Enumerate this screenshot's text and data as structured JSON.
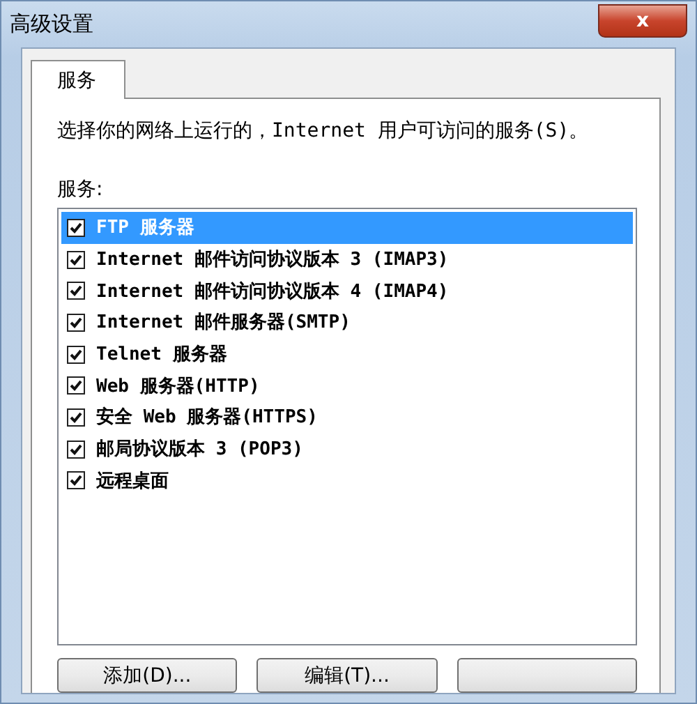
{
  "window": {
    "title": "高级设置",
    "close_label": "x"
  },
  "tabs": [
    {
      "label": "服务",
      "selected": true
    }
  ],
  "description": "选择你的网络上运行的，Internet 用户可访问的服务(S)。",
  "list_label": "服务:",
  "services": [
    {
      "label": "FTP 服务器",
      "checked": true,
      "selected": true
    },
    {
      "label": "Internet 邮件访问协议版本 3 (IMAP3)",
      "checked": true,
      "selected": false
    },
    {
      "label": "Internet 邮件访问协议版本 4 (IMAP4)",
      "checked": true,
      "selected": false
    },
    {
      "label": "Internet 邮件服务器(SMTP)",
      "checked": true,
      "selected": false
    },
    {
      "label": "Telnet 服务器",
      "checked": true,
      "selected": false
    },
    {
      "label": "Web 服务器(HTTP)",
      "checked": true,
      "selected": false
    },
    {
      "label": "安全 Web 服务器(HTTPS)",
      "checked": true,
      "selected": false
    },
    {
      "label": "邮局协议版本 3 (POP3)",
      "checked": true,
      "selected": false
    },
    {
      "label": "远程桌面",
      "checked": true,
      "selected": false
    }
  ],
  "buttons": [
    {
      "kind": "text",
      "label": "添加(D)..."
    },
    {
      "kind": "text",
      "label": "编辑(T)..."
    },
    {
      "kind": "blank"
    }
  ]
}
